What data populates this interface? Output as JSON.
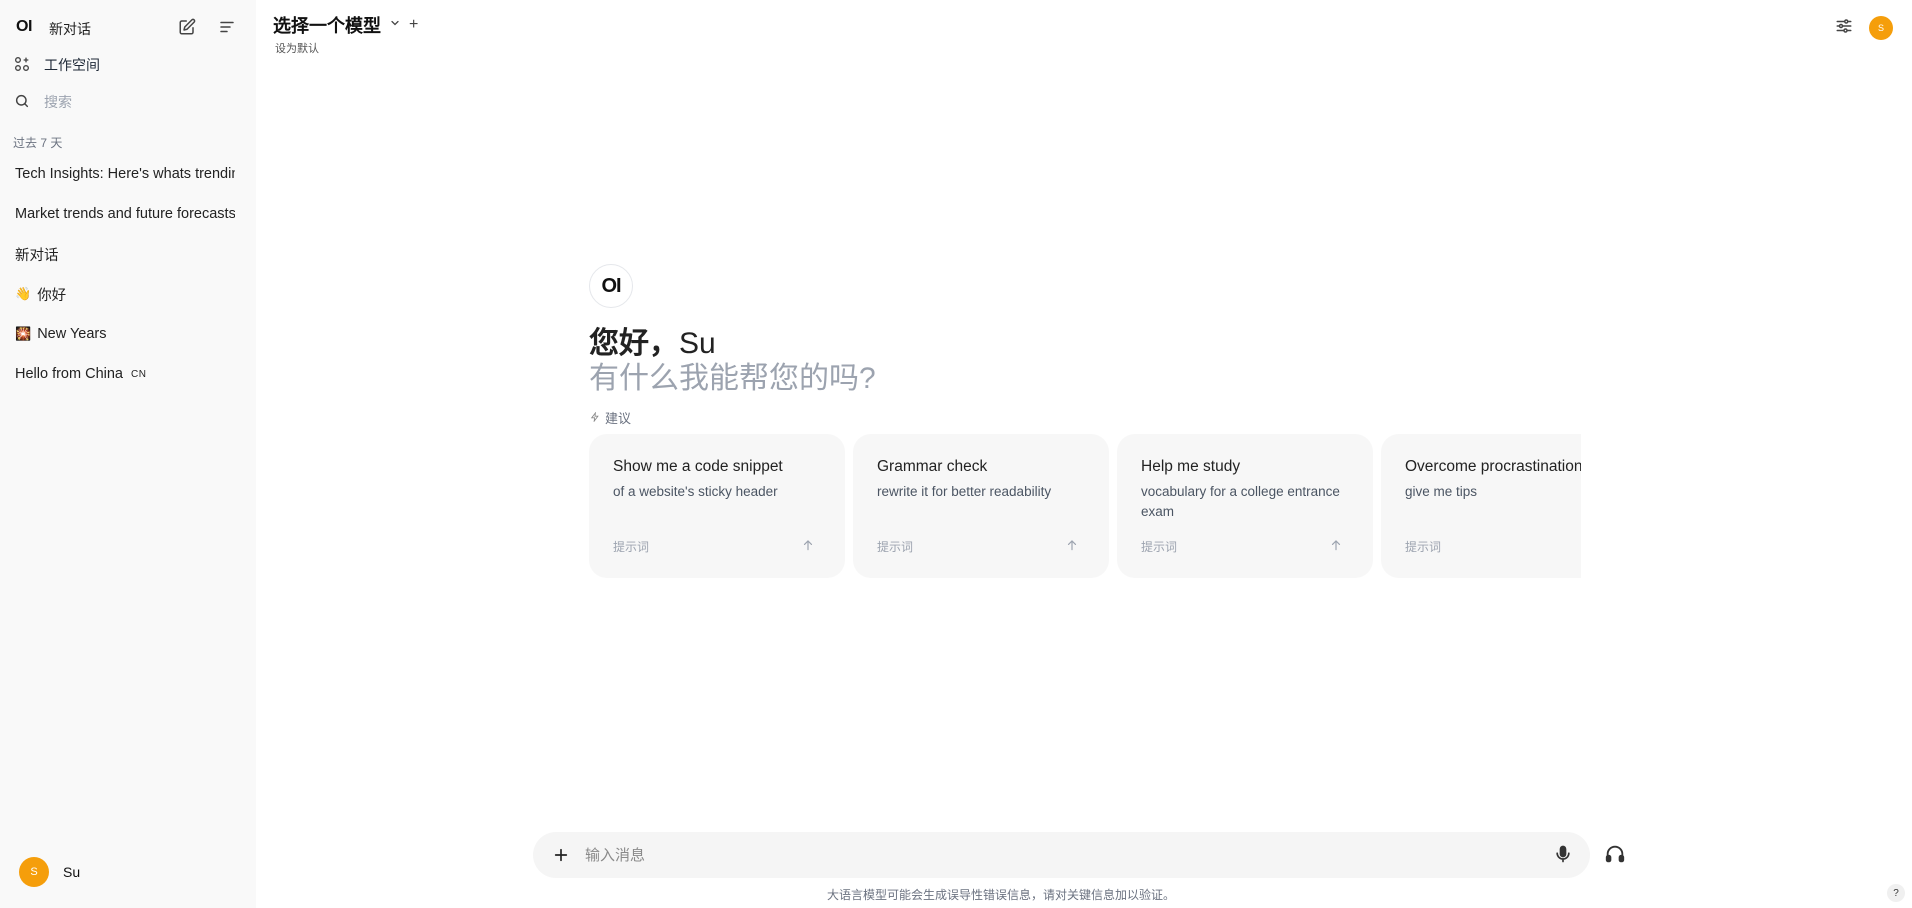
{
  "sidebar": {
    "logo": "OI",
    "new_chat_label": "新对话",
    "workspace_label": "工作空间",
    "search_placeholder": "搜索",
    "section_label": "过去 7 天",
    "chats": [
      {
        "emoji": "",
        "label": "Tech Insights: Here's whats trending"
      },
      {
        "emoji": "",
        "label": "Market trends and future forecasts"
      },
      {
        "emoji": "",
        "label": "新对话"
      },
      {
        "emoji": "👋",
        "label": "你好"
      },
      {
        "emoji": "🎇",
        "label": "New Years"
      },
      {
        "emoji": "",
        "label": "Hello from China",
        "tag": "CN"
      }
    ],
    "user": {
      "initial": "S",
      "name": "Su"
    }
  },
  "header": {
    "model_select_label": "选择一个模型",
    "add_model_label": "+",
    "set_default_label": "设为默认",
    "avatar_initial": "S"
  },
  "welcome": {
    "logo": "OI",
    "greeting": "您好，",
    "name": "Su",
    "subtitle": "有什么我能帮您的吗?",
    "suggestions_label": "建议"
  },
  "suggestions": [
    {
      "title": "Show me a code snippet",
      "subtitle": "of a website's sticky header",
      "footer": "提示词"
    },
    {
      "title": "Grammar check",
      "subtitle": "rewrite it for better readability",
      "footer": "提示词"
    },
    {
      "title": "Help me study",
      "subtitle": "vocabulary for a college entrance exam",
      "footer": "提示词"
    },
    {
      "title": "Overcome procrastination",
      "subtitle": "give me tips",
      "footer": "提示词"
    }
  ],
  "composer": {
    "placeholder": "输入消息",
    "disclaimer": "大语言模型可能会生成误导性错误信息，请对关键信息加以验证。",
    "help_label": "?"
  },
  "colors": {
    "accent": "#f59e0b",
    "sidebar_bg": "#f9f9f9",
    "card_bg": "#f7f7f7"
  }
}
